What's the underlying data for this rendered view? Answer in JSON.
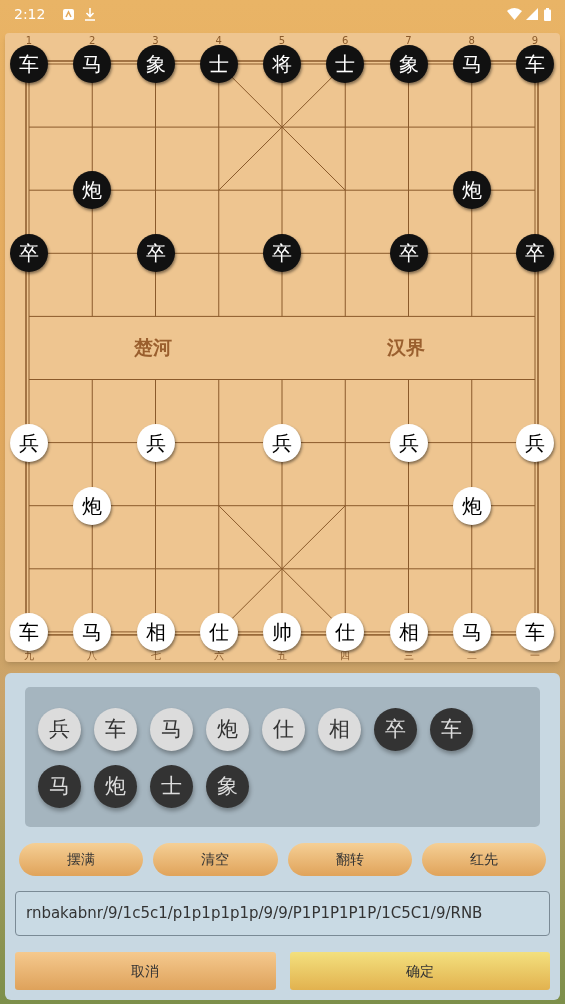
{
  "status_bar": {
    "time": "2:12"
  },
  "board": {
    "top_labels": [
      "1",
      "2",
      "3",
      "4",
      "5",
      "6",
      "7",
      "8",
      "9"
    ],
    "bottom_labels": [
      "九",
      "八",
      "七",
      "六",
      "五",
      "四",
      "三",
      "二",
      "一"
    ],
    "river": [
      "楚河",
      "汉界"
    ],
    "rows": [
      {
        "cells": [
          {
            "kind": "black_piece",
            "text": "车"
          },
          {
            "kind": "black_piece",
            "text": "马"
          },
          {
            "kind": "black_piece",
            "text": "象"
          },
          {
            "kind": "black_piece",
            "text": "士"
          },
          {
            "kind": "black_piece",
            "text": "将"
          },
          {
            "kind": "black_piece",
            "text": "士"
          },
          {
            "kind": "black_piece",
            "text": "象"
          },
          {
            "kind": "black_piece",
            "text": "马"
          },
          {
            "kind": "black_piece",
            "text": "车"
          }
        ]
      },
      {
        "cells": [
          {
            "kind": "empty"
          },
          {
            "kind": "empty"
          },
          {
            "kind": "empty"
          },
          {
            "kind": "empty"
          },
          {
            "kind": "empty"
          },
          {
            "kind": "empty"
          },
          {
            "kind": "empty"
          },
          {
            "kind": "empty"
          },
          {
            "kind": "empty"
          }
        ]
      },
      {
        "cells": [
          {
            "kind": "empty"
          },
          {
            "kind": "black_piece",
            "text": "炮"
          },
          {
            "kind": "empty"
          },
          {
            "kind": "empty"
          },
          {
            "kind": "empty"
          },
          {
            "kind": "empty"
          },
          {
            "kind": "empty"
          },
          {
            "kind": "black_piece",
            "text": "炮"
          },
          {
            "kind": "empty"
          }
        ]
      },
      {
        "cells": [
          {
            "kind": "black_piece",
            "text": "卒"
          },
          {
            "kind": "empty"
          },
          {
            "kind": "black_piece",
            "text": "卒"
          },
          {
            "kind": "empty"
          },
          {
            "kind": "black_piece",
            "text": "卒"
          },
          {
            "kind": "empty"
          },
          {
            "kind": "black_piece",
            "text": "卒"
          },
          {
            "kind": "empty"
          },
          {
            "kind": "black_piece",
            "text": "卒"
          }
        ]
      },
      {
        "cells": [
          {
            "kind": "empty"
          },
          {
            "kind": "empty"
          },
          {
            "kind": "empty"
          },
          {
            "kind": "empty"
          },
          {
            "kind": "empty"
          },
          {
            "kind": "empty"
          },
          {
            "kind": "empty"
          },
          {
            "kind": "empty"
          },
          {
            "kind": "empty"
          }
        ]
      },
      {
        "cells": [
          {
            "kind": "empty"
          },
          {
            "kind": "empty"
          },
          {
            "kind": "empty"
          },
          {
            "kind": "empty"
          },
          {
            "kind": "empty"
          },
          {
            "kind": "empty"
          },
          {
            "kind": "empty"
          },
          {
            "kind": "empty"
          },
          {
            "kind": "empty"
          }
        ]
      },
      {
        "cells": [
          {
            "kind": "red_piece",
            "text": "兵"
          },
          {
            "kind": "empty"
          },
          {
            "kind": "red_piece",
            "text": "兵"
          },
          {
            "kind": "empty"
          },
          {
            "kind": "red_piece",
            "text": "兵"
          },
          {
            "kind": "empty"
          },
          {
            "kind": "red_piece",
            "text": "兵"
          },
          {
            "kind": "empty"
          },
          {
            "kind": "red_piece",
            "text": "兵"
          }
        ]
      },
      {
        "cells": [
          {
            "kind": "empty"
          },
          {
            "kind": "red_piece",
            "text": "炮"
          },
          {
            "kind": "empty"
          },
          {
            "kind": "empty"
          },
          {
            "kind": "empty"
          },
          {
            "kind": "empty"
          },
          {
            "kind": "empty"
          },
          {
            "kind": "red_piece",
            "text": "炮"
          },
          {
            "kind": "empty"
          }
        ]
      },
      {
        "cells": [
          {
            "kind": "empty"
          },
          {
            "kind": "empty"
          },
          {
            "kind": "empty"
          },
          {
            "kind": "empty"
          },
          {
            "kind": "empty"
          },
          {
            "kind": "empty"
          },
          {
            "kind": "empty"
          },
          {
            "kind": "empty"
          },
          {
            "kind": "empty"
          }
        ]
      },
      {
        "cells": [
          {
            "kind": "red_piece",
            "text": "车"
          },
          {
            "kind": "red_piece",
            "text": "马"
          },
          {
            "kind": "red_piece",
            "text": "相"
          },
          {
            "kind": "red_piece",
            "text": "仕"
          },
          {
            "kind": "red_piece",
            "text": "帅"
          },
          {
            "kind": "red_piece",
            "text": "仕"
          },
          {
            "kind": "red_piece",
            "text": "相"
          },
          {
            "kind": "red_piece",
            "text": "马"
          },
          {
            "kind": "red_piece",
            "text": "车"
          }
        ]
      }
    ]
  },
  "palette": [
    {
      "kind": "red_piece",
      "text": "兵"
    },
    {
      "kind": "red_piece",
      "text": "车"
    },
    {
      "kind": "red_piece",
      "text": "马"
    },
    {
      "kind": "red_piece",
      "text": "炮"
    },
    {
      "kind": "red_piece",
      "text": "仕"
    },
    {
      "kind": "red_piece",
      "text": "相"
    },
    {
      "kind": "black_piece",
      "text": "卒"
    },
    {
      "kind": "black_piece",
      "text": "车"
    },
    {
      "kind": "black_piece",
      "text": "马"
    },
    {
      "kind": "black_piece",
      "text": "炮"
    },
    {
      "kind": "black_piece",
      "text": "士"
    },
    {
      "kind": "black_piece",
      "text": "象"
    }
  ],
  "tools": [
    "摆满",
    "清空",
    "翻转",
    "红先"
  ],
  "fen_field": {
    "value": "rnbakabnr/9/1c5c1/p1p1p1p1p/9/9/P1P1P1P1P/1C5C1/9/RNB"
  },
  "actions": [
    {
      "label": "取消",
      "kind": "cancel"
    },
    {
      "label": "确定",
      "kind": "confirm"
    }
  ]
}
